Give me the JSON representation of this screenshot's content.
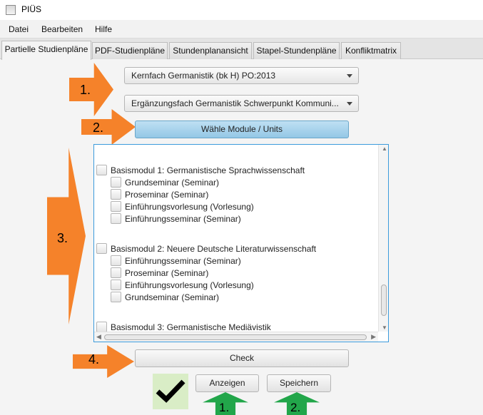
{
  "window": {
    "title": "PIÜS"
  },
  "menu": {
    "items": [
      "Datei",
      "Bearbeiten",
      "Hilfe"
    ]
  },
  "tabs": [
    {
      "label": "Partielle Studienpläne",
      "active": true
    },
    {
      "label": "PDF-Studienpläne",
      "active": false
    },
    {
      "label": "Stundenplanansicht",
      "active": false
    },
    {
      "label": "Stapel-Stundenpläne",
      "active": false
    },
    {
      "label": "Konfliktmatrix",
      "active": false
    }
  ],
  "annotations": {
    "step1": "1.",
    "step2": "2.",
    "step3": "3.",
    "step4": "4.",
    "result1": "1.",
    "result2": "2.",
    "orange": "#f5822a",
    "green": "#22a64a"
  },
  "selection": {
    "major": "Kernfach Germanistik (bk H) PO:2013",
    "minor": "Ergänzungsfach Germanistik Schwerpunkt Kommuni...",
    "select_button": "Wähle Module / Units"
  },
  "modules": [
    {
      "label": "Basismodul 1: Germanistische Sprachwissenschaft",
      "units": [
        "Grundseminar (Seminar)",
        "Proseminar (Seminar)",
        "Einführungsvorlesung (Vorlesung)",
        "Einführungsseminar (Seminar)"
      ]
    },
    {
      "label": "Basismodul 2: Neuere Deutsche Literaturwissenschaft",
      "units": [
        "Einführungsseminar (Seminar)",
        "Proseminar (Seminar)",
        "Einführungsvorlesung (Vorlesung)",
        "Grundseminar (Seminar)"
      ]
    },
    {
      "label": "Basismodul 3: Germanistische Mediävistik",
      "units": []
    }
  ],
  "actions": {
    "check": "Check",
    "show": "Anzeigen",
    "save": "Speichern"
  },
  "status": {
    "check_result": "check-mark-icon",
    "color": "#d9edc6"
  }
}
